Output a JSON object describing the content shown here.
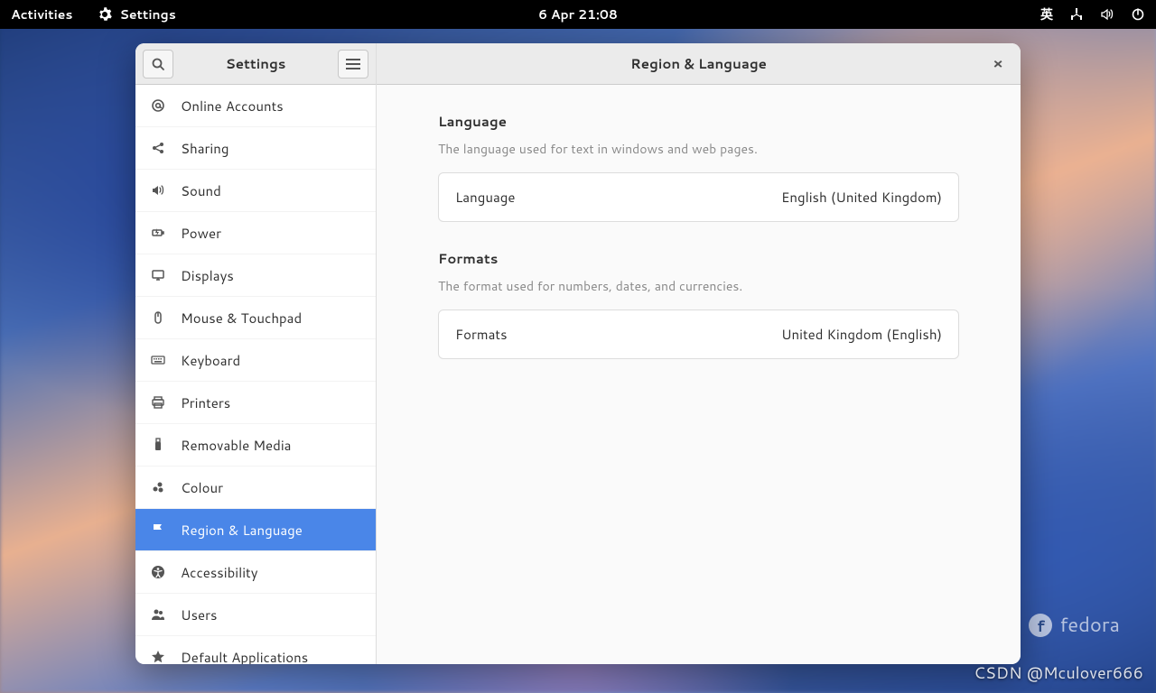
{
  "topbar": {
    "activities": "Activities",
    "app_label": "Settings",
    "datetime": "6 Apr  21:08",
    "ime_indicator": "英"
  },
  "window": {
    "sidebar_title": "Settings",
    "content_title": "Region & Language",
    "close_symbol": "×"
  },
  "sidebar": {
    "items": [
      {
        "id": "online-accounts",
        "label": "Online Accounts",
        "icon": "at-icon"
      },
      {
        "id": "sharing",
        "label": "Sharing",
        "icon": "share-icon"
      },
      {
        "id": "sound",
        "label": "Sound",
        "icon": "speaker-icon"
      },
      {
        "id": "power",
        "label": "Power",
        "icon": "battery-icon"
      },
      {
        "id": "displays",
        "label": "Displays",
        "icon": "display-icon"
      },
      {
        "id": "mouse-touchpad",
        "label": "Mouse & Touchpad",
        "icon": "mouse-icon"
      },
      {
        "id": "keyboard",
        "label": "Keyboard",
        "icon": "keyboard-icon"
      },
      {
        "id": "printers",
        "label": "Printers",
        "icon": "printer-icon"
      },
      {
        "id": "removable-media",
        "label": "Removable Media",
        "icon": "usb-icon"
      },
      {
        "id": "colour",
        "label": "Colour",
        "icon": "palette-icon"
      },
      {
        "id": "region-language",
        "label": "Region & Language",
        "icon": "flag-icon",
        "selected": true
      },
      {
        "id": "accessibility",
        "label": "Accessibility",
        "icon": "accessibility-icon"
      },
      {
        "id": "users",
        "label": "Users",
        "icon": "users-icon"
      },
      {
        "id": "default-apps",
        "label": "Default Applications",
        "icon": "star-icon"
      }
    ]
  },
  "content": {
    "language_section": {
      "heading": "Language",
      "description": "The language used for text in windows and web pages.",
      "row_label": "Language",
      "row_value": "English (United Kingdom)"
    },
    "formats_section": {
      "heading": "Formats",
      "description": "The format used for numbers, dates, and currencies.",
      "row_label": "Formats",
      "row_value": "United Kingdom (English)"
    }
  },
  "desktop": {
    "fedora_label": "fedora",
    "watermark": "CSDN @Mculover666"
  }
}
